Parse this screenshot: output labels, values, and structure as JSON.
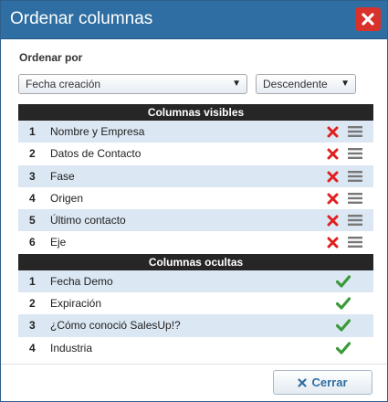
{
  "dialog": {
    "title": "Ordenar columnas",
    "close_icon": "close-icon"
  },
  "sort": {
    "label": "Ordenar por",
    "field_selected": "Fecha creación",
    "direction_selected": "Descendente"
  },
  "visible": {
    "header": "Columnas visibles",
    "rows": [
      {
        "num": "1",
        "name": "Nombre y Empresa"
      },
      {
        "num": "2",
        "name": "Datos de Contacto"
      },
      {
        "num": "3",
        "name": "Fase"
      },
      {
        "num": "4",
        "name": "Origen"
      },
      {
        "num": "5",
        "name": "Último contacto"
      },
      {
        "num": "6",
        "name": "Eje"
      }
    ]
  },
  "hidden": {
    "header": "Columnas ocultas",
    "rows": [
      {
        "num": "1",
        "name": "Fecha Demo"
      },
      {
        "num": "2",
        "name": "Expiración"
      },
      {
        "num": "3",
        "name": "¿Cómo conoció SalesUp!?"
      },
      {
        "num": "4",
        "name": "Industria"
      }
    ]
  },
  "footer": {
    "close_label": "Cerrar"
  },
  "colors": {
    "titlebar": "#2f6ea2",
    "close_red": "#d9312b",
    "remove_red": "#e02020",
    "check_green": "#3a9a3a",
    "row_alt": "#dbe7f3"
  }
}
